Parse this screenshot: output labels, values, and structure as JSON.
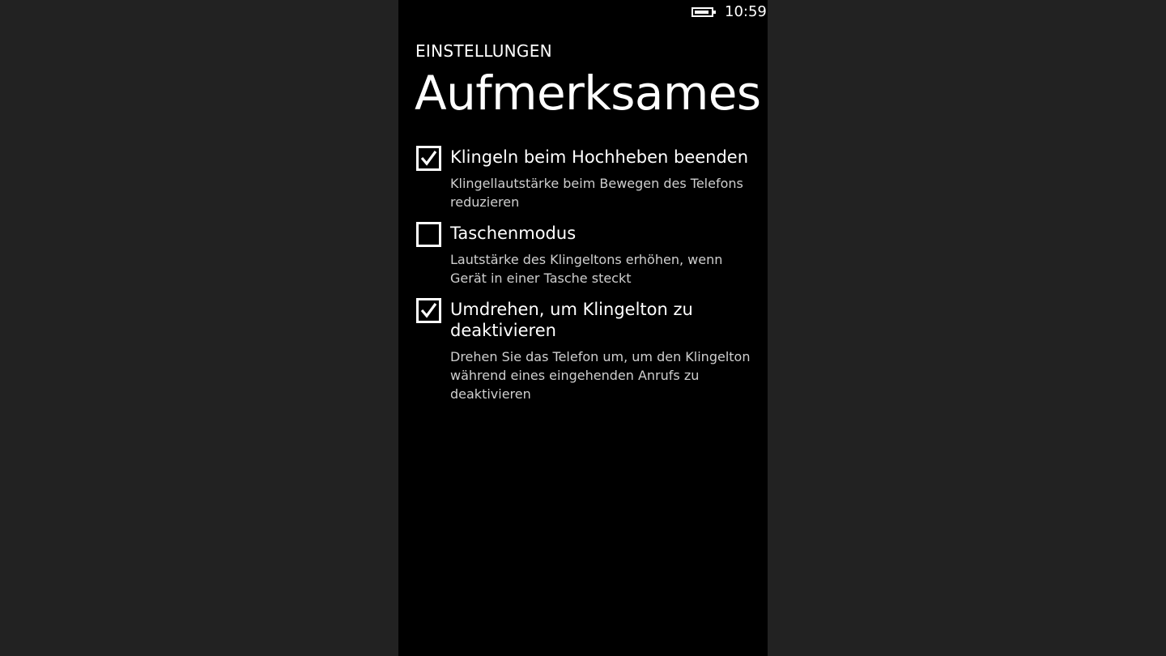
{
  "status_bar": {
    "time": "10:59",
    "battery_level": 0.9,
    "battery_icon": "battery-icon"
  },
  "header": {
    "app_title": "EINSTELLUNGEN",
    "page_title": "Aufmerksames"
  },
  "options": [
    {
      "label": "Klingeln beim Hochheben beenden",
      "description": "Klingellautstärke beim Bewegen des Telefons reduzieren",
      "checked": true
    },
    {
      "label": "Taschenmodus",
      "description": "Lautstärke des Klingeltons erhöhen, wenn Gerät in einer Tasche steckt",
      "checked": false
    },
    {
      "label": "Umdrehen, um Klingelton zu deaktivieren",
      "description": "Drehen Sie das Telefon um, um den Klingelton während eines eingehenden Anrufs zu deaktivieren",
      "checked": true
    }
  ],
  "colors": {
    "background": "#000000",
    "outer_background": "#222222",
    "text": "#ffffff",
    "secondary_text": "#cfcfcf"
  }
}
